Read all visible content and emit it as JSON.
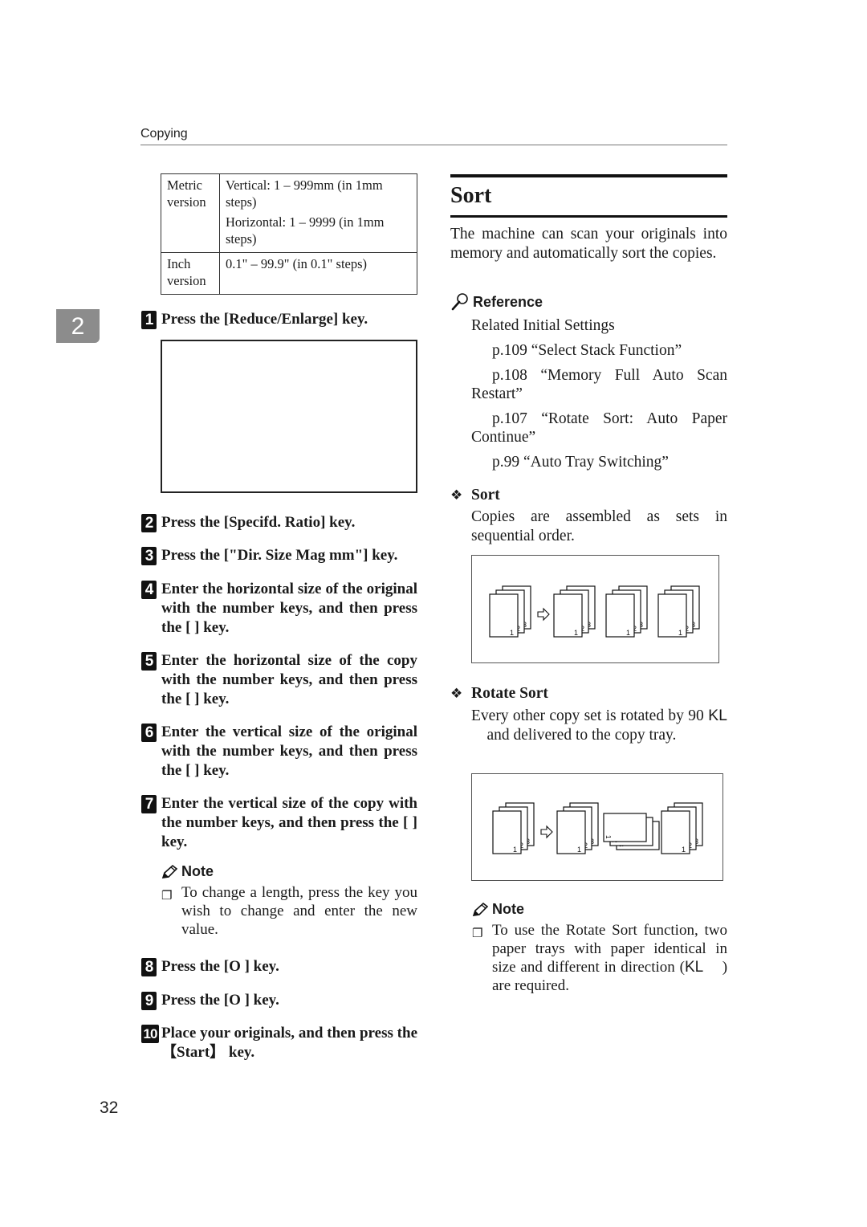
{
  "header": {
    "section_label": "Copying"
  },
  "chapter_tab": {
    "number": "2"
  },
  "spec_table": {
    "rows": [
      {
        "key": "Metric version",
        "values": [
          "Vertical: 1 – 999mm (in 1mm steps)",
          "Horizontal: 1 – 9999 (in 1mm steps)"
        ]
      },
      {
        "key": "Inch version",
        "values": [
          "0.1\" – 99.9\" (in 0.1\" steps)"
        ]
      }
    ]
  },
  "steps": [
    {
      "num": "1",
      "text": "Press the [Reduce/Enlarge] key."
    },
    {
      "num": "2",
      "text": "Press the [Specifd. Ratio] key."
    },
    {
      "num": "3",
      "text": "Press the [\"Dir. Size Mag mm\"] key."
    },
    {
      "num": "4",
      "text": "Enter the horizontal size of the original with the number keys, and then press the [ ] key."
    },
    {
      "num": "5",
      "text": "Enter the horizontal size of the copy with the number keys, and then press the [ ] key."
    },
    {
      "num": "6",
      "text": "Enter the vertical size of the original with the number keys, and then press the [ ] key."
    },
    {
      "num": "7",
      "text": "Enter the vertical size of the copy with the number keys, and then press the [ ] key."
    },
    {
      "num": "8",
      "text": "Press the [O ] key."
    },
    {
      "num": "9",
      "text": "Press the [O ] key."
    },
    {
      "num": "10",
      "text": "Place your originals, and then press the 【Start】 key."
    }
  ],
  "left_note": {
    "heading": "Note",
    "items": [
      "To change a length, press the key you wish to change and enter the new value."
    ]
  },
  "sort_section": {
    "title": "Sort",
    "intro": "The machine can scan your originals into memory and automatically sort the copies.",
    "reference": {
      "heading": "Reference",
      "lead": "Related Initial Settings",
      "items": [
        "p.109 “Select Stack Function”",
        "p.108 “Memory Full Auto Scan Restart”",
        "p.107 “Rotate Sort: Auto Paper Continue”",
        "p.99 “Auto Tray Switching”"
      ]
    },
    "sort": {
      "heading": "Sort",
      "body": "Copies are assembled as sets in sequential order."
    },
    "rotate_sort": {
      "heading": "Rotate Sort",
      "body_before": "Every other copy set is rotated by 90",
      "glyph": "KL",
      "body_after": "and delivered to the copy tray."
    },
    "note": {
      "heading": "Note",
      "before": "To use the Rotate Sort function, two paper trays with paper identical in size and different in direction (",
      "glyph": "KL",
      "after": ") are required."
    },
    "figure_labels": [
      "1",
      "2",
      "3"
    ]
  },
  "footer": {
    "page_number": "32"
  }
}
